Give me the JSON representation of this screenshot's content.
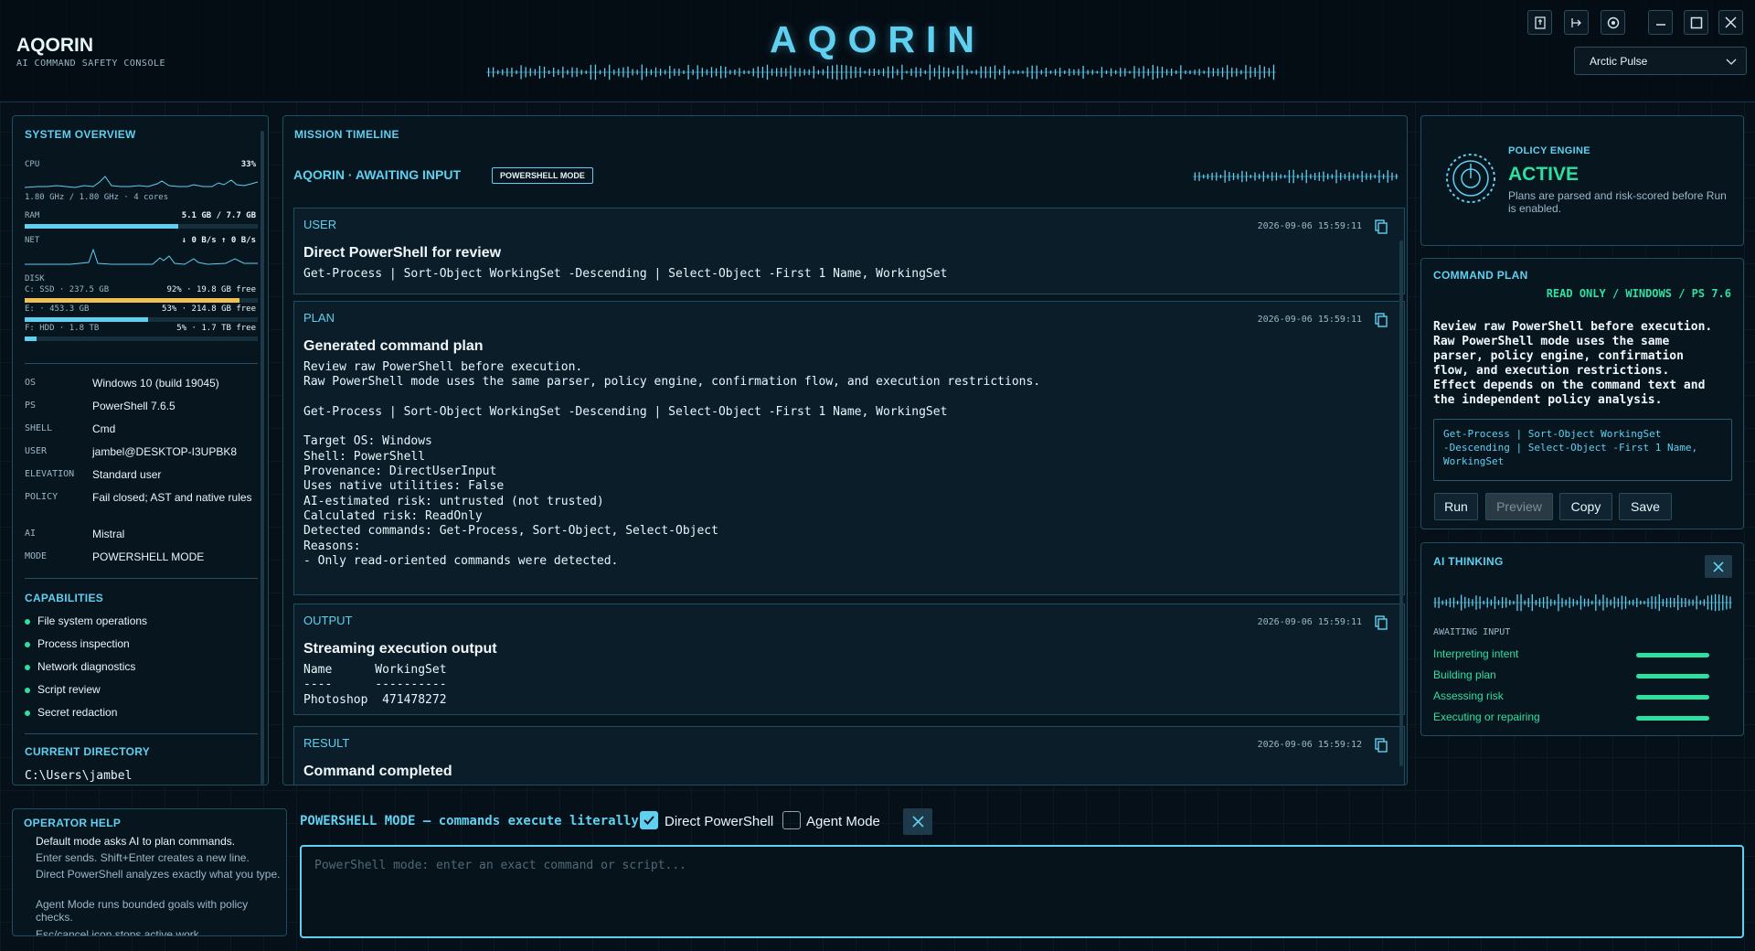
{
  "app": {
    "name": "AQORIN",
    "subtitle": "AI COMMAND SAFETY CONSOLE",
    "title": "AQORIN",
    "theme_selected": "Arctic Pulse"
  },
  "colors": {
    "accent": "#5fd0ef",
    "success": "#2ee0a0",
    "warning": "#f0c050",
    "background": "#061019"
  },
  "window_controls": [
    "export-icon",
    "logout-icon",
    "settings-icon",
    "minimize-icon",
    "maximize-icon",
    "close-icon"
  ],
  "system": {
    "title": "SYSTEM OVERVIEW",
    "cpu": {
      "label": "CPU",
      "value": "33%",
      "detail": "1.80 GHz / 1.80 GHz · 4 cores"
    },
    "ram": {
      "label": "RAM",
      "value": "5.1 GB / 7.7 GB",
      "fill": 0.66
    },
    "net": {
      "label": "NET",
      "value": "↓ 0 B/s  ↑ 0 B/s"
    },
    "disk": {
      "label": "DISK",
      "drives": [
        {
          "name": "C: SSD · 237.5 GB",
          "value": "92% · 19.8 GB free",
          "fill": 0.92,
          "color": "#f0c050"
        },
        {
          "name": "E: · 453.3 GB",
          "value": "53% · 214.8 GB free",
          "fill": 0.53,
          "color": "#5fd0ef"
        },
        {
          "name": "F: HDD · 1.8 TB",
          "value": "5% · 1.7 TB free",
          "fill": 0.05,
          "color": "#5fd0ef"
        }
      ]
    },
    "info": [
      {
        "k": "OS",
        "v": "Windows 10 (build 19045)"
      },
      {
        "k": "PS",
        "v": "PowerShell 7.6.5"
      },
      {
        "k": "SHELL",
        "v": "Cmd"
      },
      {
        "k": "USER",
        "v": "jambel@DESKTOP-I3UPBK8"
      },
      {
        "k": "ELEVATION",
        "v": "Standard user"
      },
      {
        "k": "POLICY",
        "v": "Fail closed; AST and native rules"
      },
      {
        "k": "AI",
        "v": "Mistral"
      },
      {
        "k": "MODE",
        "v": "POWERSHELL MODE"
      }
    ],
    "capabilities_title": "CAPABILITIES",
    "capabilities": [
      "File system operations",
      "Process inspection",
      "Network diagnostics",
      "Script review",
      "Secret redaction"
    ],
    "directory_title": "CURRENT DIRECTORY",
    "directory": "C:\\Users\\jambel"
  },
  "timeline": {
    "title": "MISSION TIMELINE",
    "status": "AQORIN · AWAITING INPUT",
    "mode_badge": "POWERSHELL MODE",
    "entries": [
      {
        "label": "USER",
        "time": "2026-09-06 15:59:11",
        "title": "Direct PowerShell for review",
        "body": "Get-Process | Sort-Object WorkingSet -Descending | Select-Object -First 1 Name, WorkingSet"
      },
      {
        "label": "PLAN",
        "time": "2026-09-06 15:59:11",
        "title": "Generated command plan",
        "body": "Review raw PowerShell before execution.\nRaw PowerShell mode uses the same parser, policy engine, confirmation flow, and execution restrictions.\n\nGet-Process | Sort-Object WorkingSet -Descending | Select-Object -First 1 Name, WorkingSet\n\nTarget OS: Windows\nShell: PowerShell\nProvenance: DirectUserInput\nUses native utilities: False\nAI-estimated risk: untrusted (not trusted)\nCalculated risk: ReadOnly\nDetected commands: Get-Process, Sort-Object, Select-Object\nReasons:\n- Only read-oriented commands were detected."
      },
      {
        "label": "OUTPUT",
        "time": "2026-09-06 15:59:11",
        "title": "Streaming execution output",
        "body": "Name      WorkingSet\n----      ----------\nPhotoshop  471478272"
      },
      {
        "label": "RESULT",
        "time": "2026-09-06 15:59:12",
        "title": "Command completed",
        "body": ""
      }
    ]
  },
  "policy": {
    "title": "POLICY ENGINE",
    "status": "ACTIVE",
    "desc": "Plans are parsed and risk-scored before Run is enabled."
  },
  "plan": {
    "title": "COMMAND PLAN",
    "badge": "READ ONLY / WINDOWS / PS 7.6",
    "desc": "Review raw PowerShell before execution.\nRaw PowerShell mode uses the same\nparser, policy engine, confirmation\nflow, and execution restrictions.\nEffect depends on the command text and\nthe independent policy analysis.",
    "command": "Get-Process | Sort-Object WorkingSet\n-Descending | Select-Object -First 1 Name,\nWorkingSet",
    "buttons": {
      "run": "Run",
      "preview": "Preview",
      "copy": "Copy",
      "save": "Save"
    }
  },
  "ai": {
    "title": "AI THINKING",
    "status": "AWAITING INPUT",
    "steps": [
      "Interpreting intent",
      "Building plan",
      "Assessing risk",
      "Executing or repairing"
    ]
  },
  "help": {
    "title": "OPERATOR HELP",
    "lines": [
      "Default mode asks AI to plan commands.",
      "Enter sends. Shift+Enter creates a new line.",
      "Direct PowerShell analyzes exactly what you type.",
      "Agent Mode runs bounded goals with policy checks.",
      "Esc/cancel icon stops active work."
    ]
  },
  "input": {
    "mode_label": "POWERSHELL MODE — commands execute literally",
    "direct_label": "Direct PowerShell",
    "direct_checked": true,
    "agent_label": "Agent Mode",
    "agent_checked": false,
    "placeholder": "PowerShell mode: enter an exact command or script..."
  }
}
